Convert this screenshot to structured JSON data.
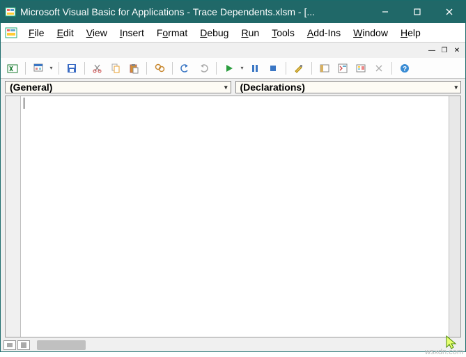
{
  "titlebar": {
    "title": "Microsoft Visual Basic for Applications - Trace Dependents.xlsm - [..."
  },
  "menu": {
    "file": "File",
    "edit": "Edit",
    "view": "View",
    "insert": "Insert",
    "format": "Format",
    "debug": "Debug",
    "run": "Run",
    "tools": "Tools",
    "addins": "Add-Ins",
    "window": "Window",
    "help": "Help"
  },
  "toolbar": {
    "tips": {
      "view_excel": "View Microsoft Excel",
      "insert": "Insert",
      "save": "Save",
      "cut": "Cut",
      "copy": "Copy",
      "paste": "Paste",
      "find": "Find",
      "undo": "Undo",
      "redo": "Redo",
      "run": "Run",
      "break": "Break",
      "reset": "Reset",
      "design": "Design Mode",
      "project": "Project Explorer",
      "properties": "Properties Window",
      "browser": "Object Browser",
      "toolbox": "Toolbox",
      "help": "Help"
    }
  },
  "combos": {
    "object": "(General)",
    "procedure": "(Declarations)"
  },
  "watermark": "wsxdn.com"
}
